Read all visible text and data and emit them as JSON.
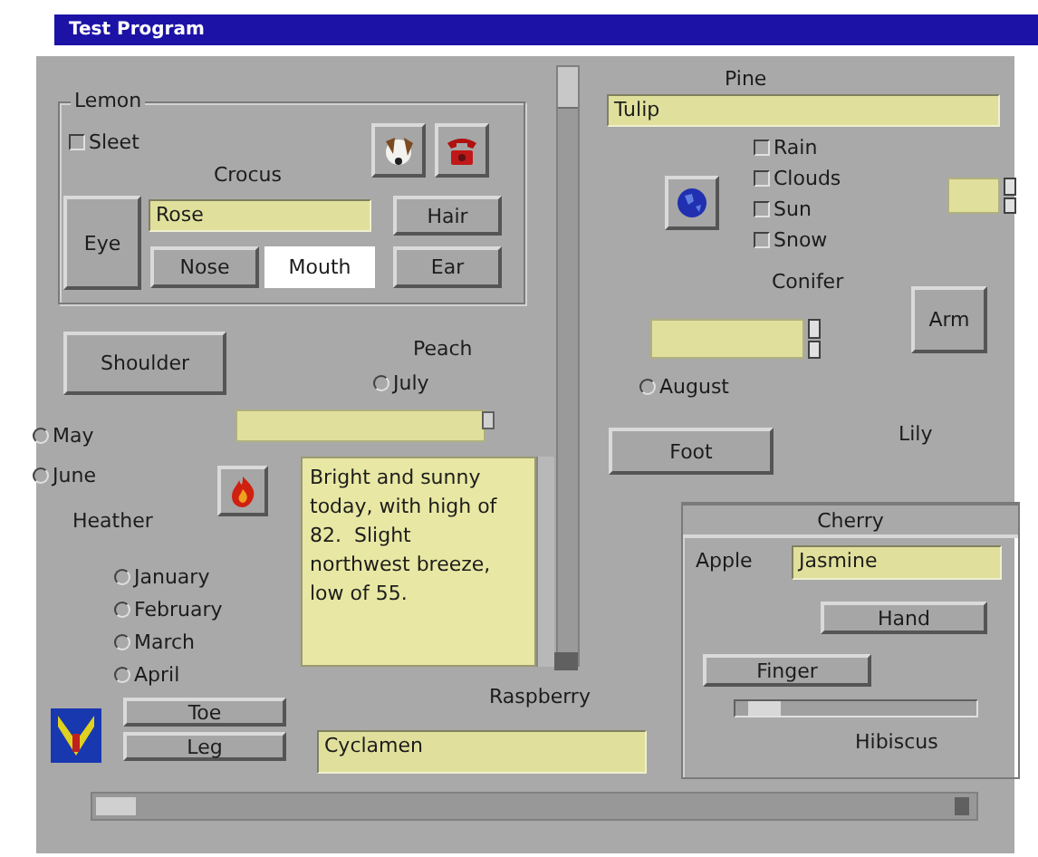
{
  "window": {
    "title": "Test Program"
  },
  "widgets": [
    {
      "kind": "group",
      "label": "Lemon"
    },
    {
      "kind": "checkbox",
      "label": "Sleet",
      "checked": false
    },
    {
      "kind": "icon_button"
    },
    {
      "kind": "icon_button"
    },
    {
      "kind": "label",
      "text": "Crocus"
    },
    {
      "kind": "button",
      "label": "Eye",
      "highlighted": false
    },
    {
      "kind": "field",
      "value": "Rose"
    },
    {
      "kind": "button",
      "label": "Hair",
      "highlighted": false
    },
    {
      "kind": "button",
      "label": "Nose",
      "highlighted": false
    },
    {
      "kind": "button",
      "label": "Mouth",
      "highlighted": true
    },
    {
      "kind": "button",
      "label": "Ear",
      "highlighted": false
    },
    {
      "kind": "button",
      "label": "Shoulder",
      "highlighted": false
    },
    {
      "kind": "label",
      "text": "Peach"
    },
    {
      "kind": "radio",
      "label": "July",
      "selected": false
    },
    {
      "kind": "radio",
      "label": "May",
      "selected": false
    },
    {
      "kind": "radio",
      "label": "June",
      "selected": false
    },
    {
      "kind": "combo"
    },
    {
      "kind": "icon_button"
    },
    {
      "kind": "label",
      "text": "Heather"
    },
    {
      "kind": "radio",
      "label": "January",
      "selected": false
    },
    {
      "kind": "radio",
      "label": "February",
      "selected": false
    },
    {
      "kind": "radio",
      "label": "March",
      "selected": false
    },
    {
      "kind": "radio",
      "label": "April",
      "selected": false
    },
    {
      "kind": "textarea",
      "value": "Bright and sunny today, with high of 82.  Slight northwest breeze, low of 55."
    },
    {
      "kind": "icon"
    },
    {
      "kind": "button",
      "label": "Toe",
      "highlighted": false
    },
    {
      "kind": "button",
      "label": "Leg",
      "highlighted": false
    },
    {
      "kind": "label",
      "text": "Raspberry"
    },
    {
      "kind": "field",
      "value": "Cyclamen"
    },
    {
      "kind": "label",
      "text": "Pine"
    },
    {
      "kind": "field",
      "value": "Tulip"
    },
    {
      "kind": "checkbox",
      "label": "Rain",
      "checked": false
    },
    {
      "kind": "checkbox",
      "label": "Clouds",
      "checked": false
    },
    {
      "kind": "checkbox",
      "label": "Sun",
      "checked": false
    },
    {
      "kind": "checkbox",
      "label": "Snow",
      "checked": false
    },
    {
      "kind": "icon_button"
    },
    {
      "kind": "spin"
    },
    {
      "kind": "label",
      "text": "Conifer"
    },
    {
      "kind": "button",
      "label": "Arm",
      "highlighted": false
    },
    {
      "kind": "spin"
    },
    {
      "kind": "radio",
      "label": "August",
      "selected": false
    },
    {
      "kind": "button",
      "label": "Foot",
      "highlighted": false
    },
    {
      "kind": "label",
      "text": "Lily"
    },
    {
      "kind": "tabgroup",
      "label": "Cherry"
    },
    {
      "kind": "label",
      "text": "Apple"
    },
    {
      "kind": "field",
      "value": "Jasmine"
    },
    {
      "kind": "button",
      "label": "Hand",
      "highlighted": false
    },
    {
      "kind": "button",
      "label": "Finger",
      "highlighted": false
    },
    {
      "kind": "slider",
      "level": 0.05
    },
    {
      "kind": "label",
      "text": "Hibiscus"
    }
  ]
}
